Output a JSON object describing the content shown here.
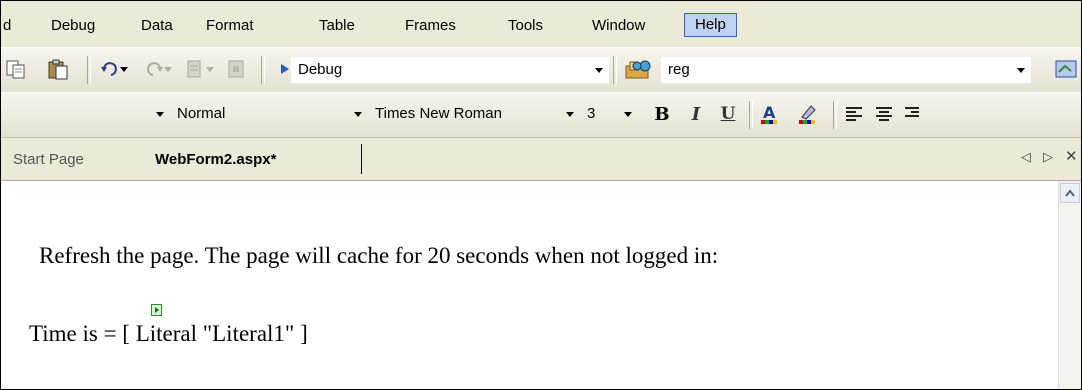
{
  "menu": {
    "items": [
      "Debug",
      "Data",
      "Format",
      "Table",
      "Frames",
      "Tools",
      "Window",
      "Help"
    ],
    "partial_left": "d",
    "active": "Help"
  },
  "toolbar1": {
    "config_combo": "Debug",
    "find_combo": "reg"
  },
  "toolbar2": {
    "style_combo": "Normal",
    "font_combo": "Times New Roman",
    "size_combo": "3",
    "bold": "B",
    "italic": "I",
    "underline": "U"
  },
  "tabs": {
    "start_page": "Start Page",
    "active_doc": "WebForm2.aspx*",
    "nav_left": "◁",
    "nav_right": "▷",
    "close": "✕"
  },
  "editor": {
    "line1": "Refresh the page. The page will cache for 20 seconds when not logged in:",
    "line2": "Time is = [ Literal \"Literal1\" ]"
  },
  "colors": {
    "chrome": "#ece9d8",
    "menu_highlight": "#c1d2ee",
    "menu_highlight_border": "#316ac5"
  }
}
